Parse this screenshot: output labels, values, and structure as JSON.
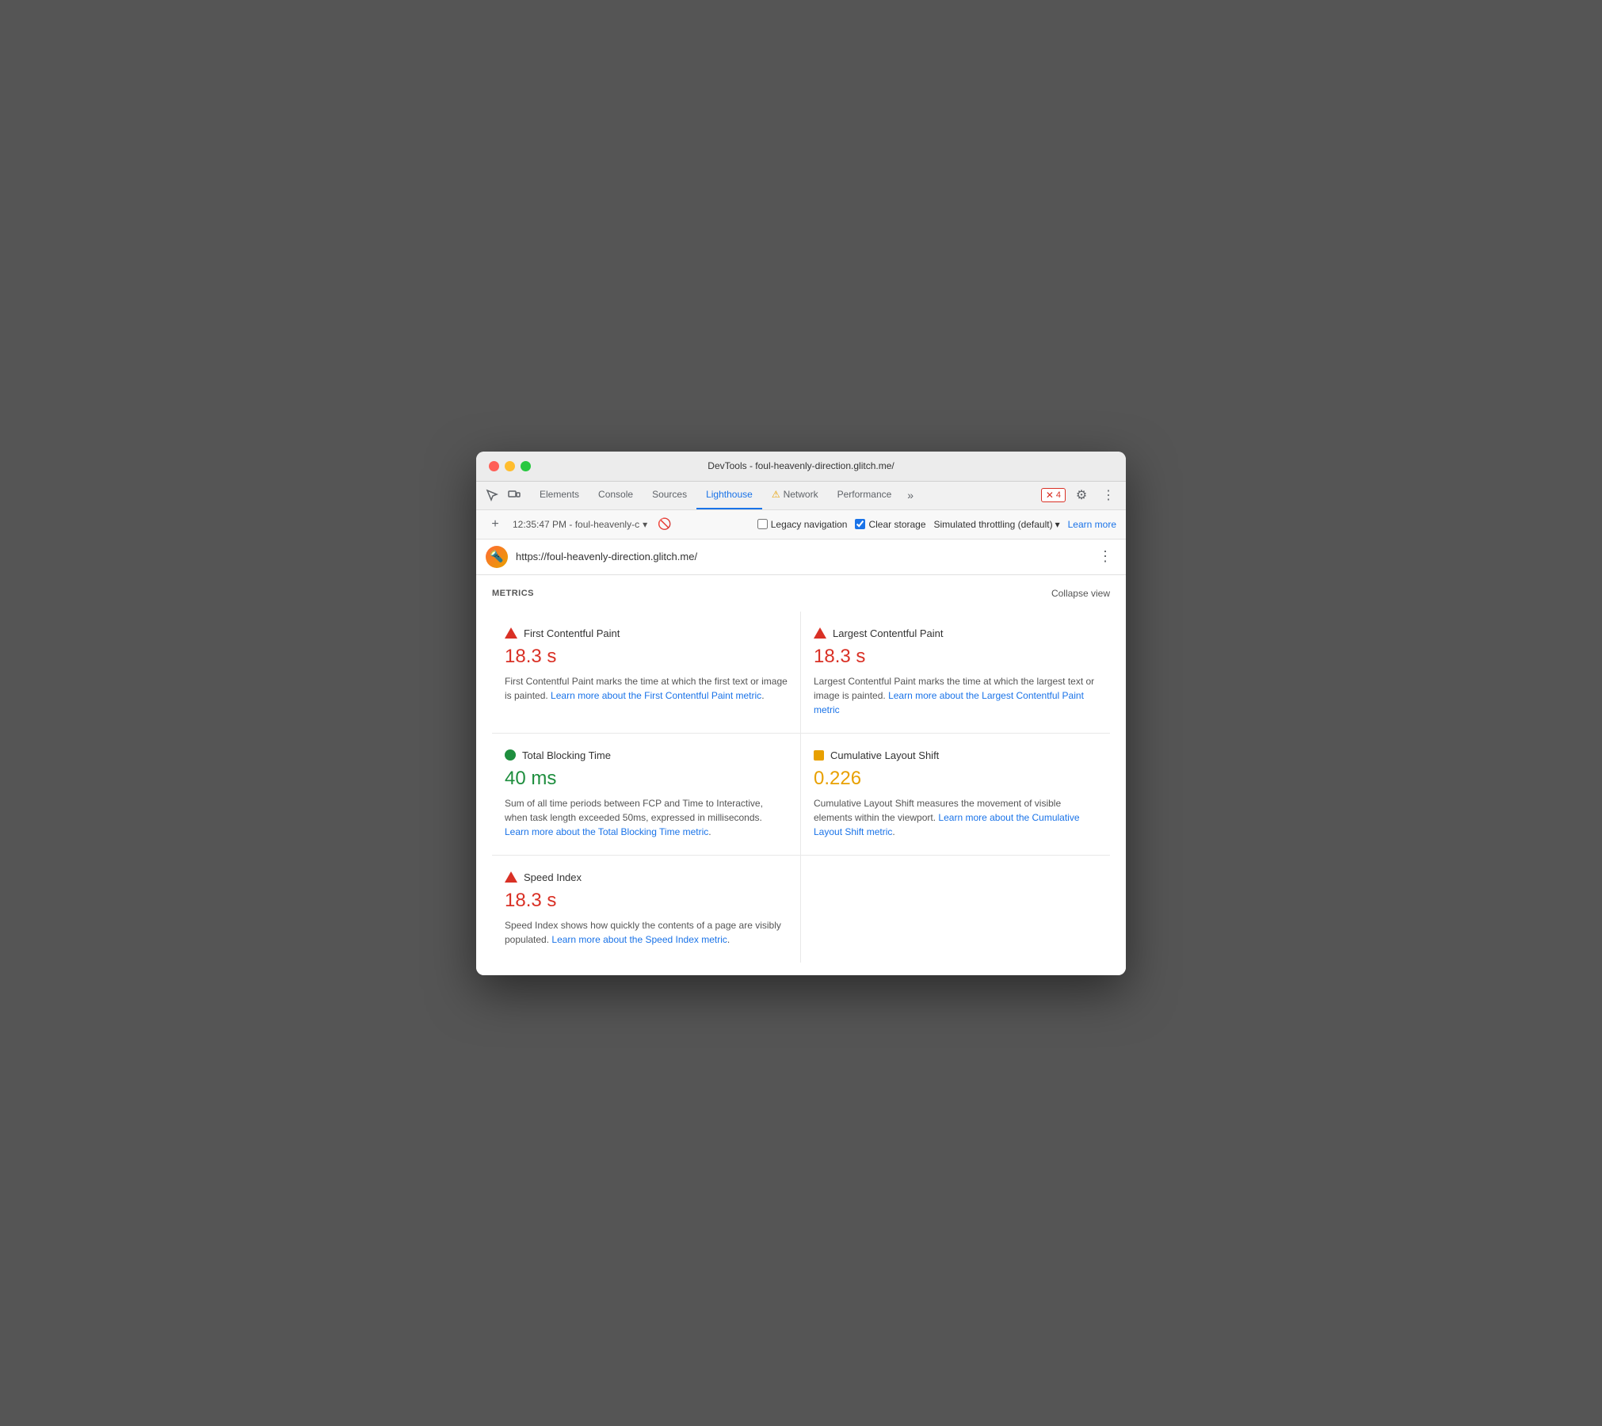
{
  "window": {
    "title": "DevTools - foul-heavenly-direction.glitch.me/",
    "traffic_lights": [
      "red",
      "yellow",
      "green"
    ]
  },
  "tabs": {
    "elements": "Elements",
    "console": "Console",
    "sources": "Sources",
    "lighthouse": "Lighthouse",
    "network": "Network",
    "performance": "Performance",
    "more": "»",
    "active": "lighthouse"
  },
  "toolbar_right": {
    "error_count": "4",
    "settings_label": "⚙",
    "more_label": "⋮"
  },
  "secondary_toolbar": {
    "time": "12:35:47 PM",
    "url_short": "foul-heavenly-c",
    "no_throttle_icon": "🚫",
    "legacy_nav_label": "Legacy navigation",
    "legacy_nav_checked": false,
    "clear_storage_label": "Clear storage",
    "clear_storage_checked": true,
    "throttle_label": "Simulated throttling (default)",
    "learn_more": "Learn more"
  },
  "url_bar": {
    "url": "https://foul-heavenly-direction.glitch.me/",
    "menu_icon": "⋮"
  },
  "metrics": {
    "section_title": "METRICS",
    "collapse_label": "Collapse view",
    "items": [
      {
        "id": "fcp",
        "name": "First Contentful Paint",
        "icon_type": "red-triangle",
        "value": "18.3 s",
        "value_color": "red",
        "description": "First Contentful Paint marks the time at which the first text or image is painted.",
        "link_text": "Learn more about the First Contentful Paint metric",
        "link_url": "#"
      },
      {
        "id": "lcp",
        "name": "Largest Contentful Paint",
        "icon_type": "red-triangle",
        "value": "18.3 s",
        "value_color": "red",
        "description": "Largest Contentful Paint marks the time at which the largest text or image is painted.",
        "link_text": "Learn more about the Largest Contentful Paint metric",
        "link_url": "#"
      },
      {
        "id": "tbt",
        "name": "Total Blocking Time",
        "icon_type": "green-circle",
        "value": "40 ms",
        "value_color": "green",
        "description": "Sum of all time periods between FCP and Time to Interactive, when task length exceeded 50ms, expressed in milliseconds.",
        "link_text": "Learn more about the Total Blocking Time metric",
        "link_url": "#"
      },
      {
        "id": "cls",
        "name": "Cumulative Layout Shift",
        "icon_type": "orange-square",
        "value": "0.226",
        "value_color": "orange",
        "description": "Cumulative Layout Shift measures the movement of visible elements within the viewport.",
        "link_text": "Learn more about the Cumulative Layout Shift metric",
        "link_url": "#"
      },
      {
        "id": "si",
        "name": "Speed Index",
        "icon_type": "red-triangle",
        "value": "18.3 s",
        "value_color": "red",
        "description": "Speed Index shows how quickly the contents of a page are visibly populated.",
        "link_text": "Learn more about the Speed Index metric",
        "link_url": "#"
      }
    ]
  }
}
